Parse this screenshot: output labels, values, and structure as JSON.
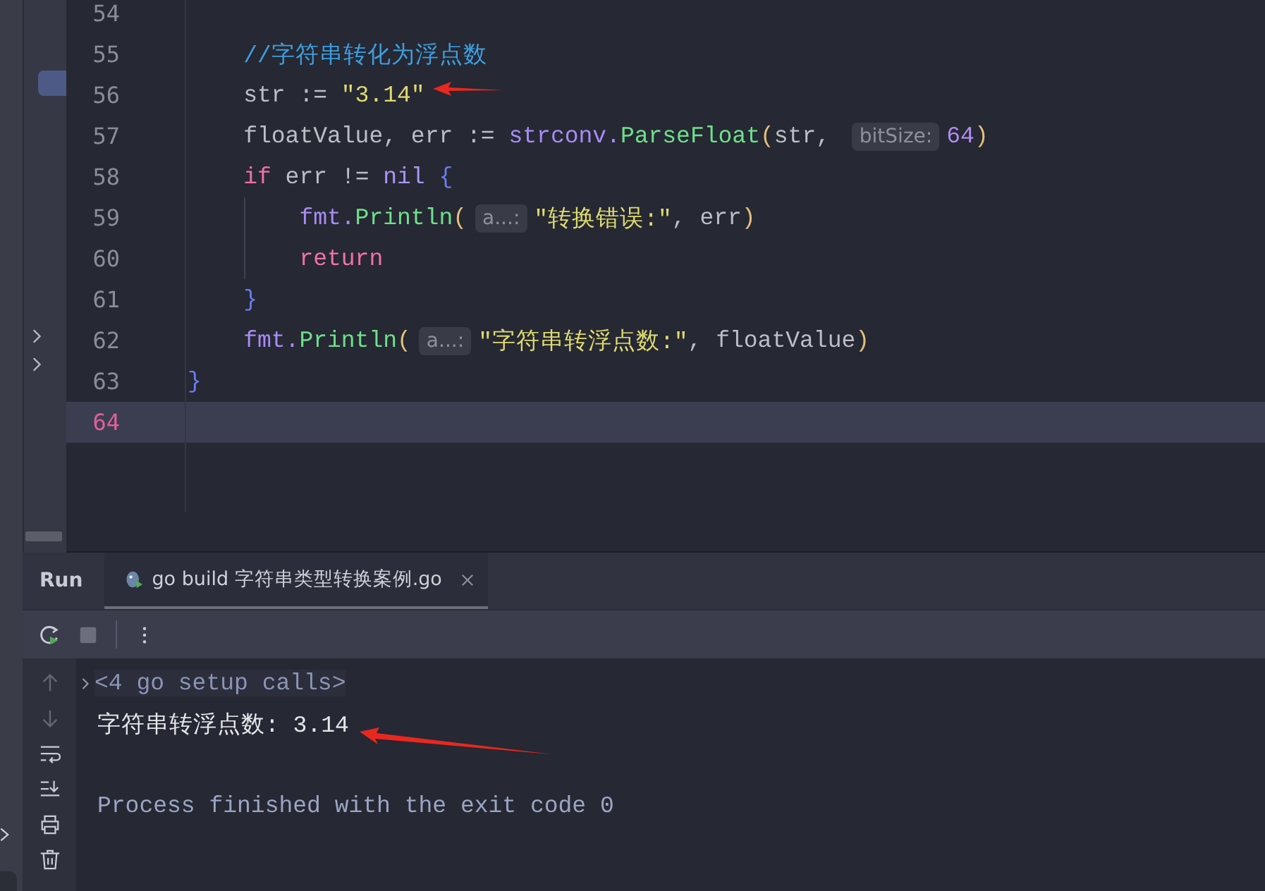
{
  "editor": {
    "lines": [
      {
        "kind": "block",
        "children": [
          {
            "number": "54",
            "current": false
          },
          {
            "number": "55",
            "current": false,
            "tokens": [
              {
                "kind": "comment",
                "text": "//字符串转化为浮点数"
              }
            ]
          },
          {
            "number": "56",
            "current": false,
            "tokens": [
              {
                "kind": "plain",
                "text": "str := "
              },
              {
                "kind": "string",
                "text": "\"3.14\""
              }
            ]
          },
          {
            "number": "57",
            "current": false,
            "tokens": [
              {
                "kind": "plain",
                "text": "floatValue, err := "
              },
              {
                "kind": "package",
                "text": "strconv."
              },
              {
                "kind": "function",
                "text": "ParseFloat"
              },
              {
                "kind": "paren",
                "text": "("
              },
              {
                "kind": "plain",
                "text": "str, "
              },
              {
                "kind": "hint",
                "text": "bitSize:"
              },
              {
                "kind": "number",
                "text": "64"
              },
              {
                "kind": "paren",
                "text": ")"
              }
            ]
          },
          {
            "number": "58",
            "current": false,
            "tokens": [
              {
                "kind": "keyword",
                "text": "if"
              },
              {
                "kind": "plain",
                "text": " err != "
              },
              {
                "kind": "constant",
                "text": "nil"
              },
              {
                "kind": "brace",
                "text": " {"
              }
            ],
            "children": [
              {
                "number": "59",
                "current": false,
                "tokens": [
                  {
                    "kind": "package",
                    "text": "fmt."
                  },
                  {
                    "kind": "function",
                    "text": "Println"
                  },
                  {
                    "kind": "paren",
                    "text": "("
                  },
                  {
                    "kind": "hint",
                    "text": "a...:"
                  },
                  {
                    "kind": "string",
                    "text": "\"转换错误:\""
                  },
                  {
                    "kind": "plain",
                    "text": ", err"
                  },
                  {
                    "kind": "paren",
                    "text": ")"
                  }
                ]
              },
              {
                "number": "60",
                "current": false,
                "tokens": [
                  {
                    "kind": "keyword",
                    "text": "return"
                  }
                ]
              }
            ]
          },
          {
            "number": "61",
            "current": false,
            "tokens": [
              {
                "kind": "brace",
                "text": "}"
              }
            ]
          },
          {
            "number": "62",
            "current": false,
            "tokens": [
              {
                "kind": "package",
                "text": "fmt."
              },
              {
                "kind": "function",
                "text": "Println"
              },
              {
                "kind": "paren",
                "text": "("
              },
              {
                "kind": "hint",
                "text": "a...:"
              },
              {
                "kind": "string",
                "text": "\"字符串转浮点数:\""
              },
              {
                "kind": "plain",
                "text": ", floatValue"
              },
              {
                "kind": "paren",
                "text": ")"
              }
            ]
          }
        ]
      },
      {
        "number": "63",
        "current": false,
        "tokens": [
          {
            "kind": "brace",
            "text": "}"
          }
        ]
      },
      {
        "number": "64",
        "current": true
      }
    ]
  },
  "run": {
    "title": "Run",
    "tabs": [
      {
        "label": "go build 字符串类型转换案例.go",
        "selected": true
      }
    ],
    "toolbar": [
      {
        "kind": "rerun",
        "disabled": false
      },
      {
        "kind": "stop",
        "disabled": true
      },
      {
        "kind": "more",
        "disabled": false
      }
    ],
    "side_actions": [
      {
        "kind": "up",
        "disabled": true
      },
      {
        "kind": "down",
        "disabled": true
      },
      {
        "kind": "wrap",
        "disabled": false
      },
      {
        "kind": "scroll-end",
        "disabled": false
      },
      {
        "kind": "print",
        "disabled": false
      },
      {
        "kind": "trash",
        "disabled": false
      }
    ],
    "console": [
      {
        "kind": "folded",
        "text": "<4 go setup calls>",
        "expanded": false
      },
      {
        "kind": "output",
        "text": "字符串转浮点数: 3.14"
      },
      {
        "kind": "system",
        "text": "Process finished with the exit code 0"
      }
    ]
  }
}
